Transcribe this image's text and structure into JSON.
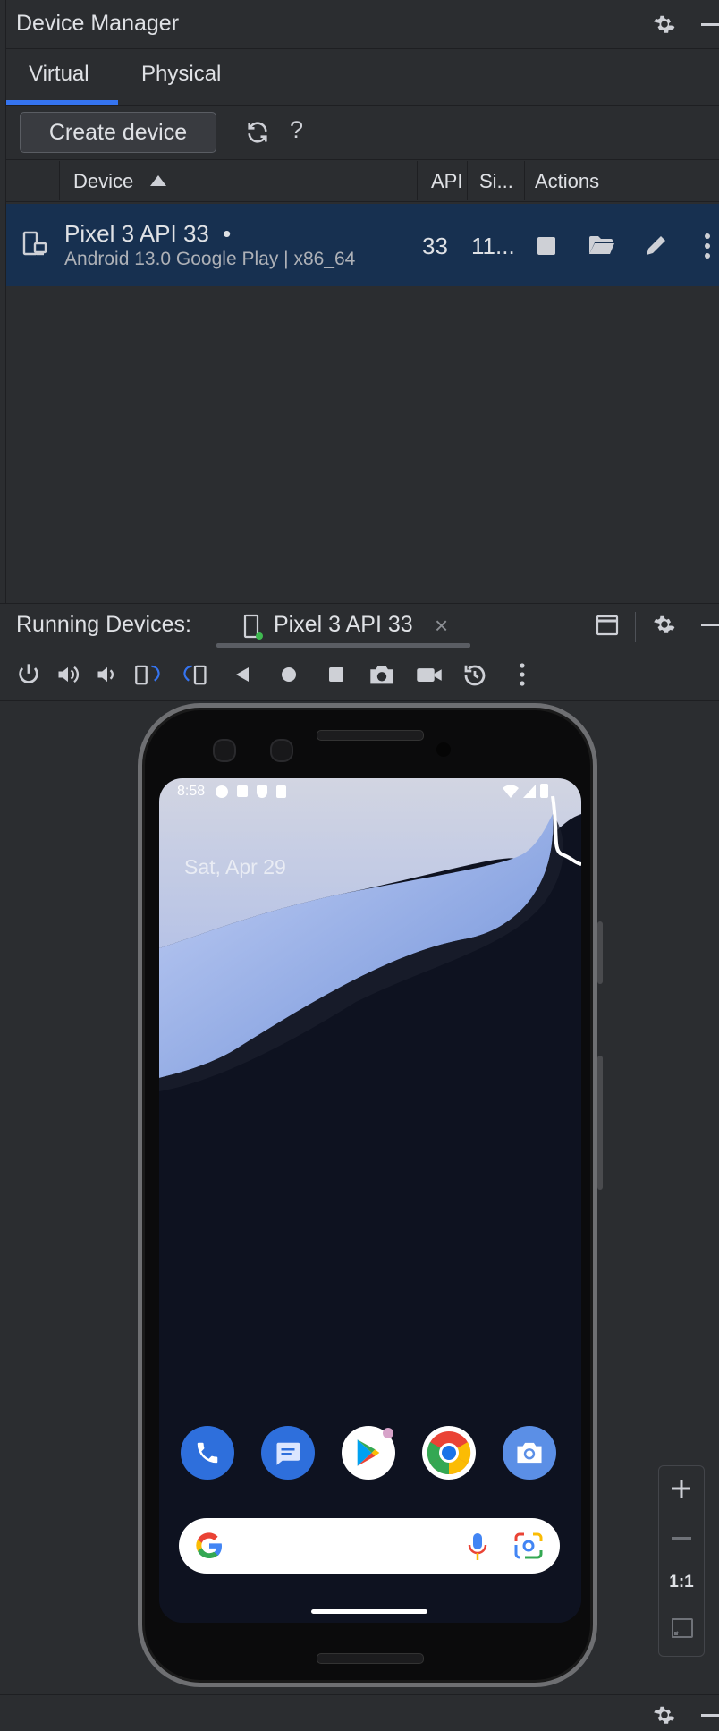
{
  "device_manager": {
    "title": "Device Manager",
    "tabs": [
      {
        "label": "Virtual",
        "active": true
      },
      {
        "label": "Physical",
        "active": false
      }
    ],
    "create_button": "Create device",
    "help_label": "?",
    "columns": {
      "device": "Device",
      "api": "API",
      "size": "Si...",
      "actions": "Actions"
    },
    "rows": [
      {
        "name": "Pixel 3 API 33",
        "status_dot": "•",
        "subtitle": "Android 13.0 Google Play | x86_64",
        "api": "33",
        "size": "11..."
      }
    ]
  },
  "running_devices": {
    "title": "Running Devices:",
    "tab_label": "Pixel 3 API 33",
    "close": "×"
  },
  "emulator": {
    "status_time": "8:58",
    "date": "Sat, Apr 29"
  },
  "zoom": {
    "one_to_one": "1:1"
  },
  "colors": {
    "accent": "#3574f0",
    "selected_row": "#173050",
    "panel_bg": "#2b2d30"
  },
  "icons": [
    "gear-icon",
    "minimize-icon",
    "refresh-icon",
    "help-icon",
    "sort-asc-icon",
    "device-icon",
    "stop-icon",
    "folder-icon",
    "edit-icon",
    "more-icon",
    "power-icon",
    "volume-up-icon",
    "volume-down-icon",
    "rotate-left-icon",
    "rotate-right-icon",
    "back-icon",
    "home-icon",
    "overview-icon",
    "camera-icon",
    "video-icon",
    "reset-icon",
    "window-icon",
    "zoom-in-icon",
    "zoom-out-icon",
    "fit-icon"
  ]
}
